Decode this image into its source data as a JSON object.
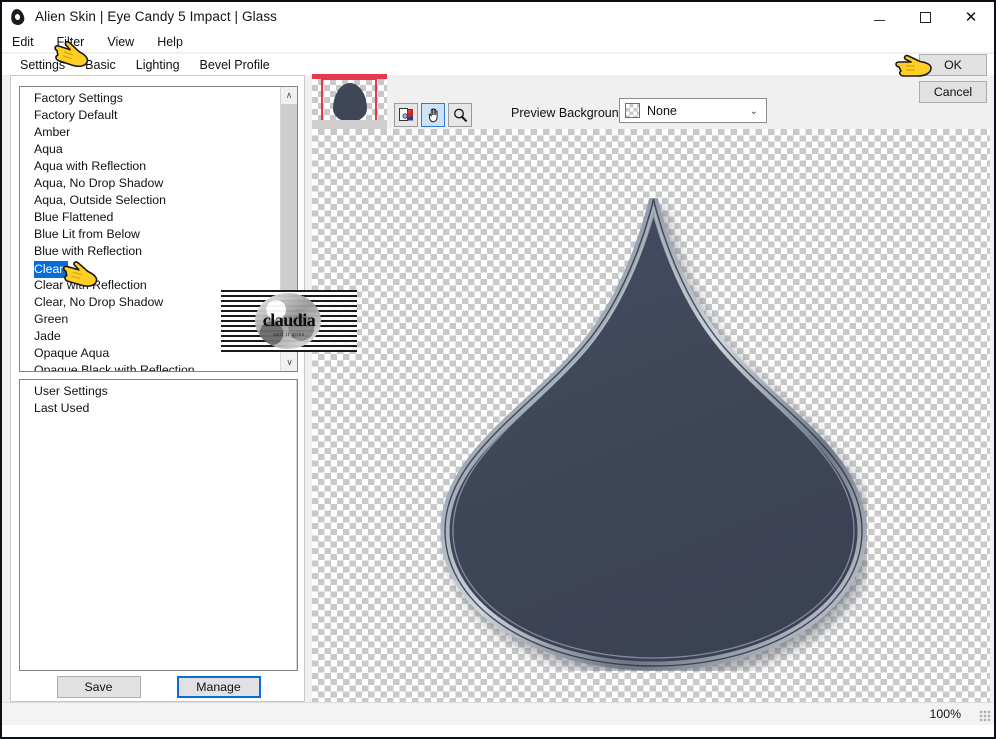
{
  "window": {
    "title": "Alien Skin | Eye Candy 5 Impact | Glass",
    "icon": "droplet-icon",
    "minimize_label": "—",
    "maximize_label": "□",
    "close_label": "✕"
  },
  "menubar": {
    "items": [
      {
        "label": "Edit"
      },
      {
        "label": "Filter"
      },
      {
        "label": "View"
      },
      {
        "label": "Help"
      }
    ]
  },
  "tabs": [
    {
      "label": "Settings",
      "active": true
    },
    {
      "label": "Basic",
      "active": false
    },
    {
      "label": "Lighting",
      "active": false
    },
    {
      "label": "Bevel Profile",
      "active": false
    }
  ],
  "factory_list": {
    "items": [
      "Factory Settings",
      "Factory Default",
      "Amber",
      "Aqua",
      "Aqua with Reflection",
      "Aqua, No Drop Shadow",
      "Aqua, Outside Selection",
      "Blue Flattened",
      "Blue Lit from Below",
      "Blue with Reflection",
      "Clear",
      "Clear with Reflection",
      "Clear, No Drop Shadow",
      "Green",
      "Jade",
      "Opaque Aqua",
      "Opaque Black with Reflection"
    ],
    "selected": "Clear",
    "scroll_up_glyph": "∧",
    "scroll_down_glyph": "∨"
  },
  "user_list": {
    "items": [
      "User Settings",
      "Last Used"
    ]
  },
  "preset_buttons": {
    "save_label": "Save",
    "manage_label": "Manage"
  },
  "preview_toolbar": {
    "tools": [
      {
        "name": "image-preview-tool",
        "active": false
      },
      {
        "name": "hand-pan-tool",
        "active": true
      },
      {
        "name": "zoom-magnifier-tool",
        "active": false
      }
    ],
    "background_label": "Preview Background:",
    "background_value": "None",
    "dropdown_arrow": "⌄"
  },
  "dialog_buttons": {
    "ok_label": "OK",
    "cancel_label": "Cancel"
  },
  "statusbar": {
    "zoom": "100%"
  },
  "watermark": {
    "text": "claudia",
    "subtext": "and it goes"
  },
  "colors": {
    "accent_blue": "#0a6cd8",
    "selection_blue": "#0a6cd8",
    "glass_fill": "#3f4658",
    "red_frame": "#e8394a",
    "checker_gray": "#c9c9c9",
    "panel_bg": "#ffffff",
    "button_bg": "#e1e1e1"
  }
}
